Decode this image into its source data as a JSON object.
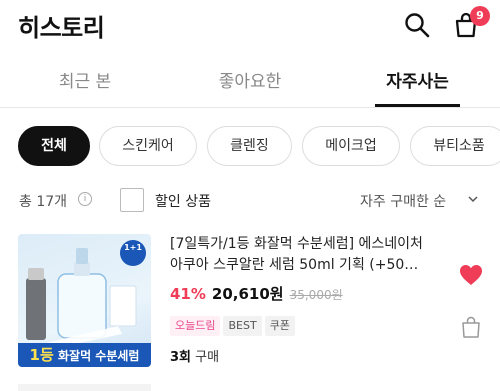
{
  "header": {
    "title": "히스토리",
    "cart_count": "9"
  },
  "tabs": [
    {
      "label": "최근 본"
    },
    {
      "label": "좋아요한"
    },
    {
      "label": "자주사는"
    }
  ],
  "chips": [
    {
      "label": "전체"
    },
    {
      "label": "스킨케어"
    },
    {
      "label": "클렌징"
    },
    {
      "label": "메이크업"
    },
    {
      "label": "뷰티소품"
    }
  ],
  "filter": {
    "count": "총 17개",
    "info_icon": "i",
    "discount_label": "할인 상품",
    "sort": "자주 구매한 순"
  },
  "products": [
    {
      "name": "[7일특가/1등 화잘먹 수분세럼] 에스네이처 아쿠아 스쿠알란 세럼 50ml 기획 (+50…",
      "discount": "41%",
      "price": "20,610원",
      "original_price": "35,000원",
      "tags": [
        "오늘드림",
        "BEST",
        "쿠폰"
      ],
      "purchase_count": "3회",
      "purchase_suffix": " 구매",
      "thumb_badge": "1+1",
      "thumb_rank": "1등",
      "thumb_caption": "화잘먹 수분세럼"
    }
  ],
  "colors": {
    "accent": "#ef3d57",
    "liked_heart": "#ef3d57",
    "thumb_blue": "#1a57b6"
  }
}
